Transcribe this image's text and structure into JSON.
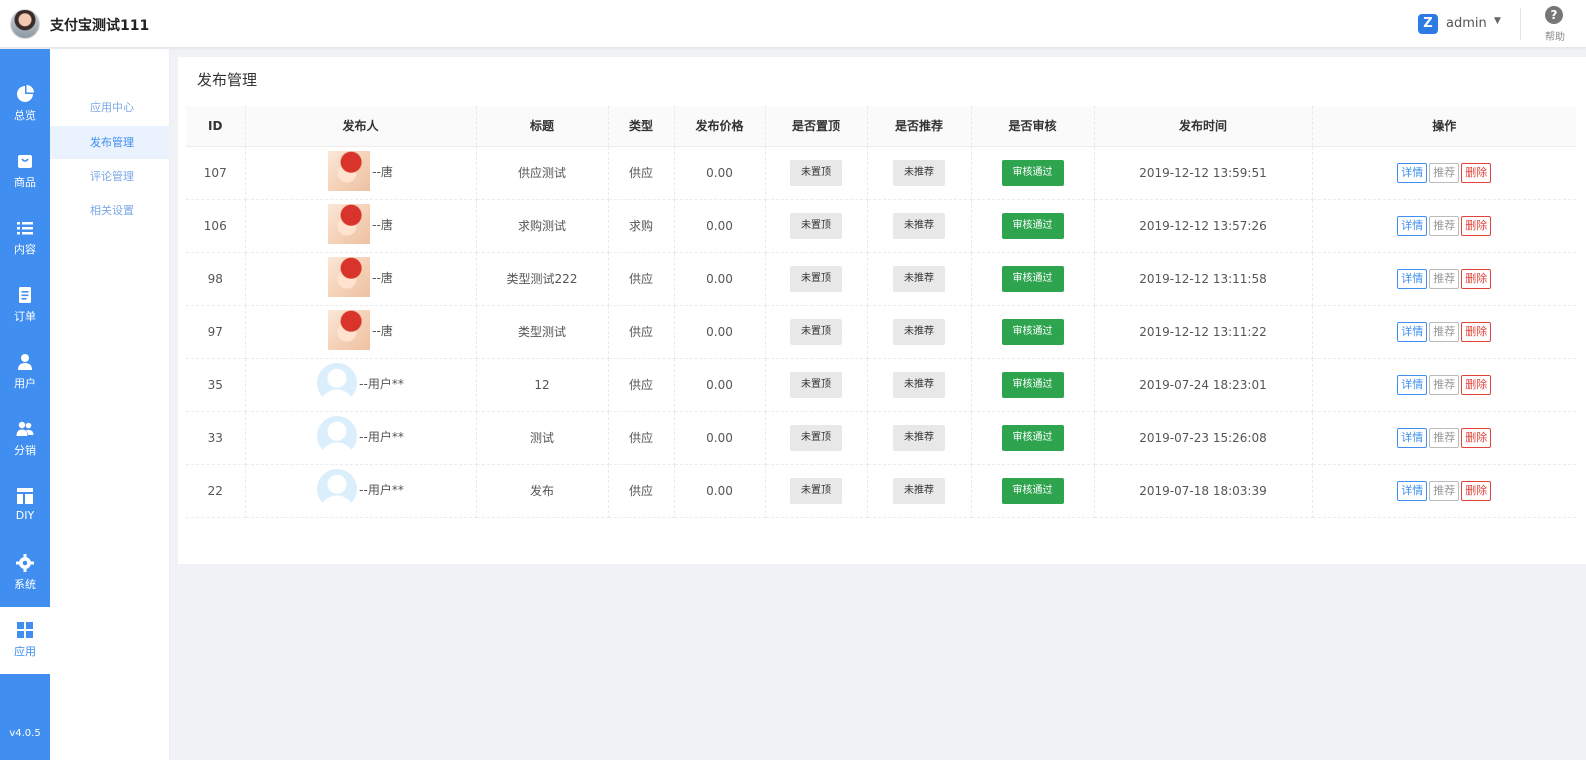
{
  "header": {
    "app_title": "支付宝测试111",
    "admin_name": "admin",
    "help_label": "帮助"
  },
  "nav": {
    "items": [
      {
        "label": "总览",
        "icon": "pie-chart-icon"
      },
      {
        "label": "商品",
        "icon": "shop-bag-icon"
      },
      {
        "label": "内容",
        "icon": "list-icon"
      },
      {
        "label": "订单",
        "icon": "document-icon"
      },
      {
        "label": "用户",
        "icon": "user-icon"
      },
      {
        "label": "分销",
        "icon": "users-icon"
      },
      {
        "label": "DIY",
        "icon": "layout-icon"
      },
      {
        "label": "系统",
        "icon": "gear-icon"
      },
      {
        "label": "应用",
        "icon": "grid-icon"
      }
    ],
    "version": "v4.0.5"
  },
  "subnav": {
    "items": [
      {
        "label": "应用中心"
      },
      {
        "label": "发布管理"
      },
      {
        "label": "评论管理"
      },
      {
        "label": "相关设置"
      }
    ]
  },
  "page": {
    "title": "发布管理"
  },
  "table": {
    "headers": [
      "ID",
      "发布人",
      "标题",
      "类型",
      "发布价格",
      "是否置顶",
      "是否推荐",
      "是否审核",
      "发布时间",
      "操作"
    ],
    "rows": [
      {
        "id": "107",
        "avatar": "anime",
        "publisher": "--唐",
        "title": "供应测试",
        "type": "供应",
        "price": "0.00",
        "top": "未置顶",
        "recommend": "未推荐",
        "audit": "审核通过",
        "time": "2019-12-12 13:59:51"
      },
      {
        "id": "106",
        "avatar": "anime",
        "publisher": "--唐",
        "title": "求购测试",
        "type": "求购",
        "price": "0.00",
        "top": "未置顶",
        "recommend": "未推荐",
        "audit": "审核通过",
        "time": "2019-12-12 13:57:26"
      },
      {
        "id": "98",
        "avatar": "anime",
        "publisher": "--唐",
        "title": "类型测试222",
        "type": "供应",
        "price": "0.00",
        "top": "未置顶",
        "recommend": "未推荐",
        "audit": "审核通过",
        "time": "2019-12-12 13:11:58"
      },
      {
        "id": "97",
        "avatar": "anime",
        "publisher": "--唐",
        "title": "类型测试",
        "type": "供应",
        "price": "0.00",
        "top": "未置顶",
        "recommend": "未推荐",
        "audit": "审核通过",
        "time": "2019-12-12 13:11:22"
      },
      {
        "id": "35",
        "avatar": "default",
        "publisher": "--用户**",
        "title": "12",
        "type": "供应",
        "price": "0.00",
        "top": "未置顶",
        "recommend": "未推荐",
        "audit": "审核通过",
        "time": "2019-07-24 18:23:01"
      },
      {
        "id": "33",
        "avatar": "default",
        "publisher": "--用户**",
        "title": "测试",
        "type": "供应",
        "price": "0.00",
        "top": "未置顶",
        "recommend": "未推荐",
        "audit": "审核通过",
        "time": "2019-07-23 15:26:08"
      },
      {
        "id": "22",
        "avatar": "default",
        "publisher": "--用户**",
        "title": "发布",
        "type": "供应",
        "price": "0.00",
        "top": "未置顶",
        "recommend": "未推荐",
        "audit": "审核通过",
        "time": "2019-07-18 18:03:39"
      }
    ],
    "ops": {
      "detail": "详情",
      "recommend": "推荐",
      "delete": "删除"
    }
  },
  "colors": {
    "primary": "#3f8ef0",
    "success": "#2ea44f",
    "danger": "#e0433a"
  }
}
